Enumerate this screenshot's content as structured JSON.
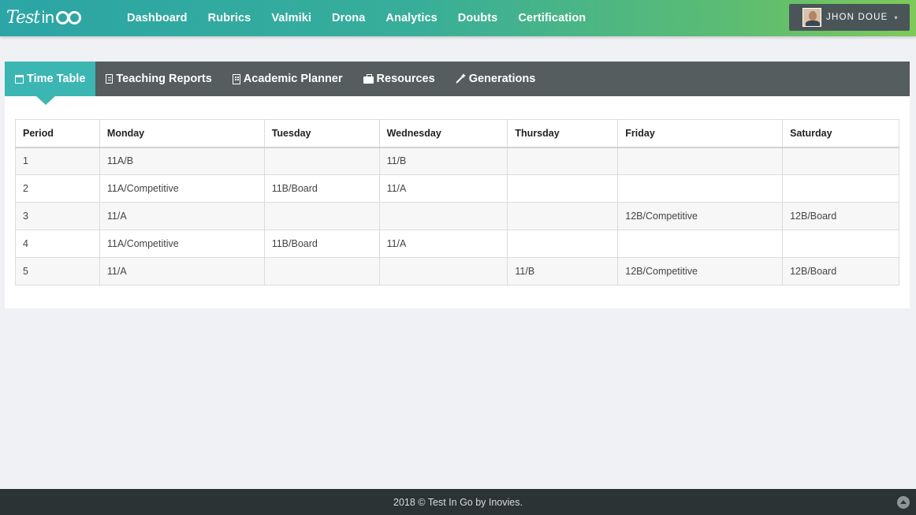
{
  "header": {
    "logo_text": "Test",
    "logo_suffix": "in",
    "nav": [
      "Dashboard",
      "Rubrics",
      "Valmiki",
      "Drona",
      "Analytics",
      "Doubts",
      "Certification"
    ],
    "user_name": "JHON DOUE",
    "user_caret": "▾"
  },
  "tabs": [
    {
      "label": "Time Table",
      "icon": "calendar-icon",
      "active": true
    },
    {
      "label": "Teaching Reports",
      "icon": "document-icon",
      "active": false
    },
    {
      "label": "Academic Planner",
      "icon": "building-icon",
      "active": false
    },
    {
      "label": "Resources",
      "icon": "briefcase-icon",
      "active": false
    },
    {
      "label": "Generations",
      "icon": "magic-wand-icon",
      "active": false
    }
  ],
  "timetable": {
    "columns": [
      "Period",
      "Monday",
      "Tuesday",
      "Wednesday",
      "Thursday",
      "Friday",
      "Saturday"
    ],
    "rows": [
      [
        "1",
        "11A/B",
        "",
        "11/B",
        "",
        "",
        ""
      ],
      [
        "2",
        "11A/Competitive",
        "11B/Board",
        "11/A",
        "",
        "",
        ""
      ],
      [
        "3",
        "11/A",
        "",
        "",
        "",
        "12B/Competitive",
        "12B/Board"
      ],
      [
        "4",
        "11A/Competitive",
        "11B/Board",
        "11/A",
        "",
        "",
        ""
      ],
      [
        "5",
        "11/A",
        "",
        "",
        "11/B",
        "12B/Competitive",
        "12B/Board"
      ]
    ]
  },
  "footer": {
    "text": "2018 © Test In Go by Inovies."
  },
  "colors": {
    "nav_gradient_start": "#2ba5a6",
    "nav_gradient_end": "#7ec95a",
    "tab_bar": "#555d5f",
    "tab_active": "#3bb6b3",
    "footer": "#2b3334"
  }
}
